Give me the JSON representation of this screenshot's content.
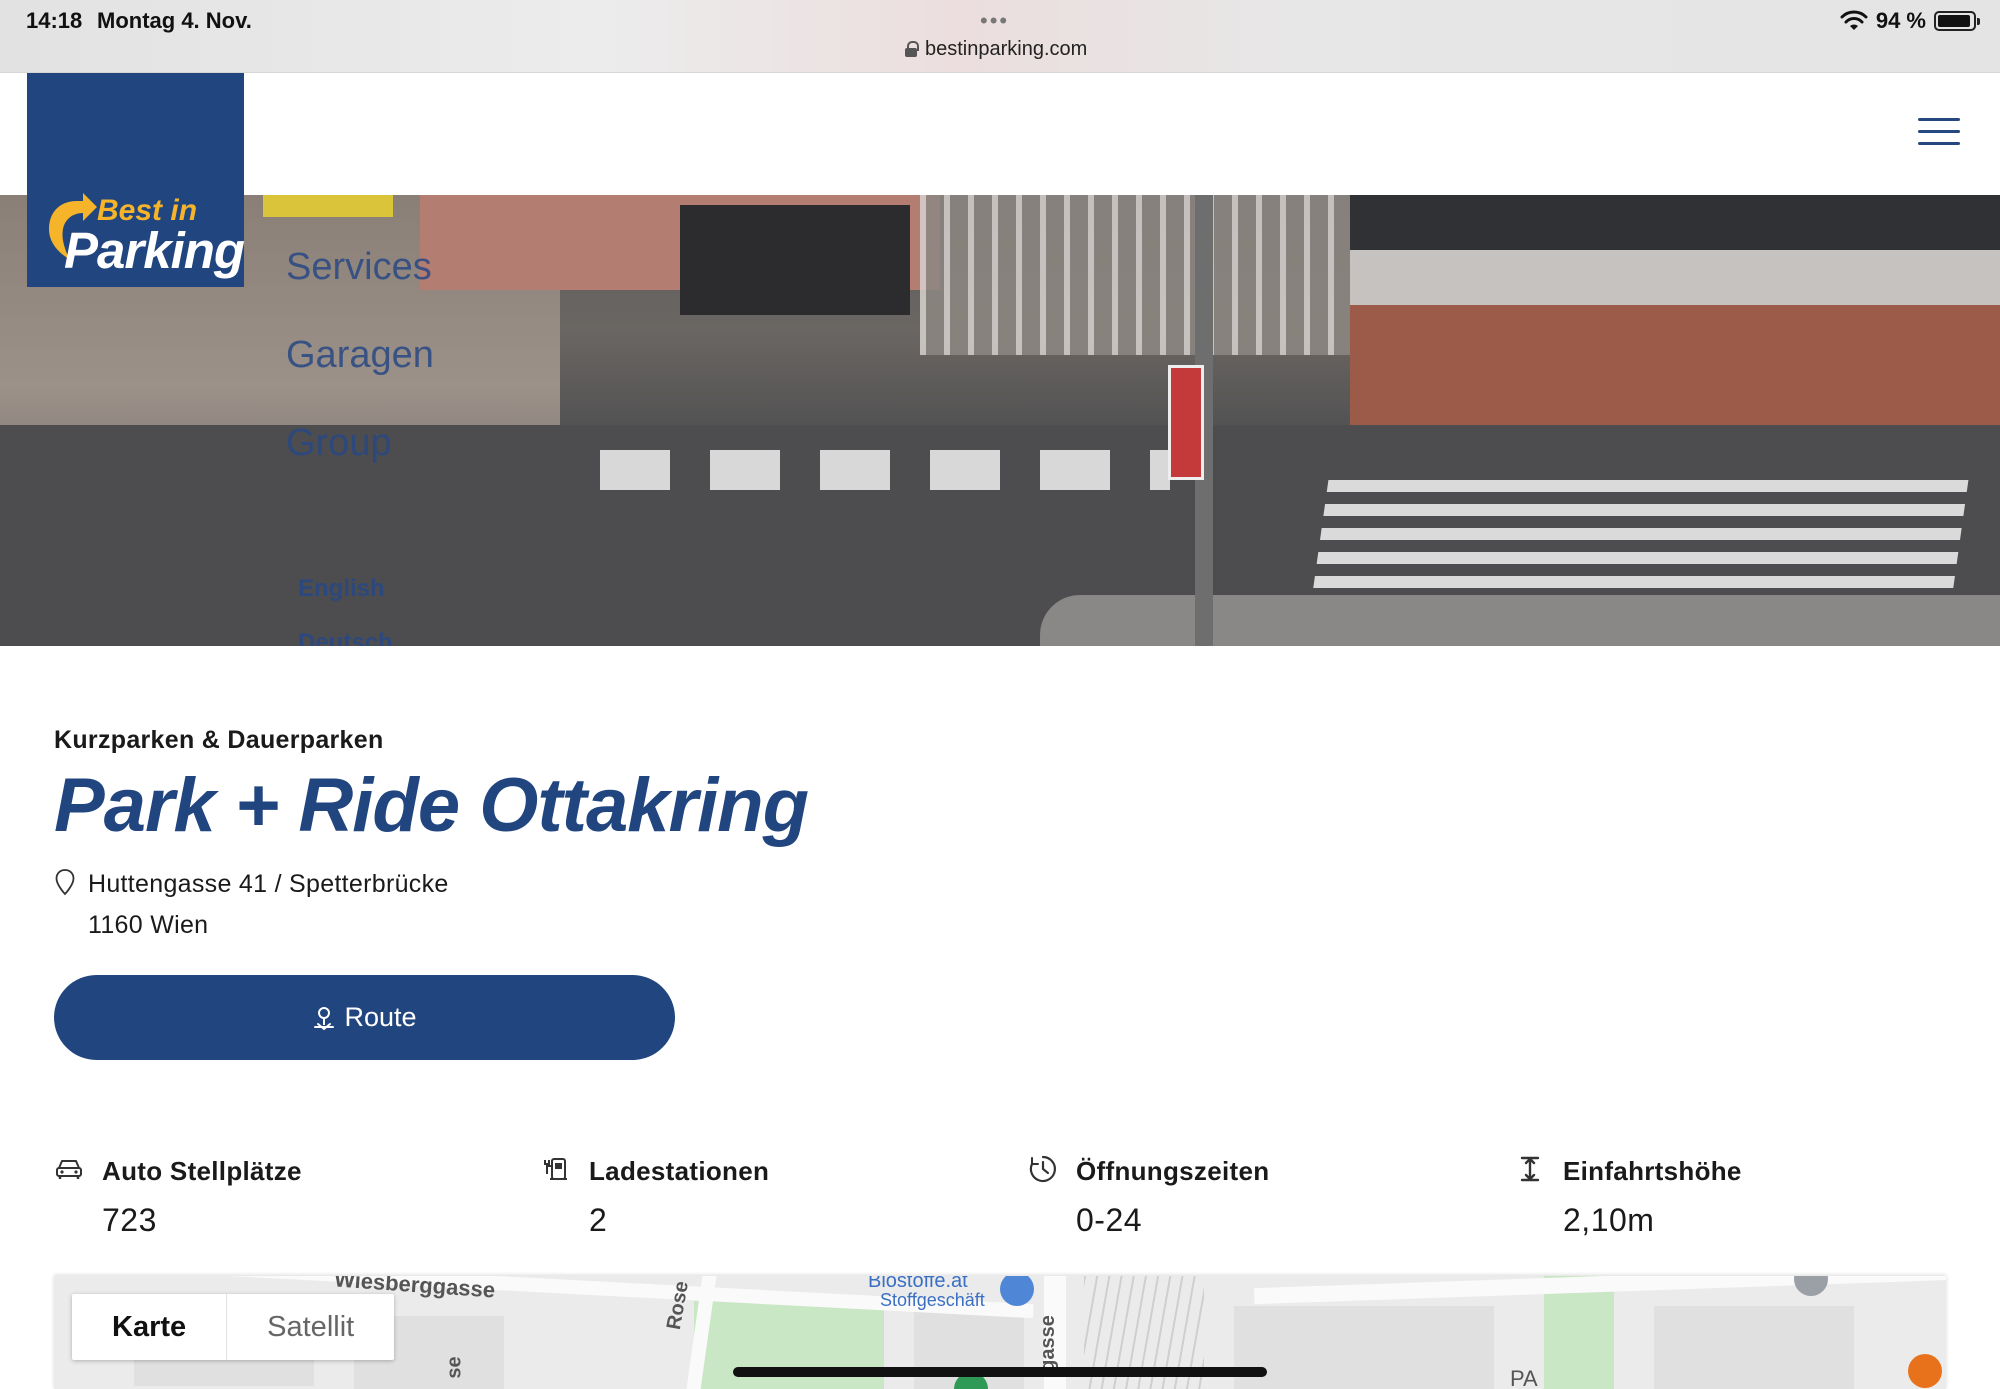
{
  "status_bar": {
    "time": "14:18",
    "date": "Montag 4. Nov.",
    "url": "bestinparking.com",
    "battery": "94 %",
    "battery_level": 0.94
  },
  "logo": {
    "line1": "Best in",
    "line2": "Parking"
  },
  "hero": {
    "nav": [
      "Services",
      "Garagen",
      "Group"
    ],
    "languages": [
      "English",
      "Deutsch"
    ]
  },
  "detail": {
    "subtitle": "Kurzparken & Dauerparken",
    "title": "Park + Ride Ottakring",
    "address_line1": "Huttengasse 41 / Spetterbrücke",
    "address_line2": "1160 Wien",
    "route_label": "Route"
  },
  "stats": [
    {
      "icon": "car-icon",
      "label": "Auto Stellplätze",
      "value": "723"
    },
    {
      "icon": "charging-station-icon",
      "label": "Ladestationen",
      "value": "2"
    },
    {
      "icon": "clock-icon",
      "label": "Öffnungszeiten",
      "value": "0-24"
    },
    {
      "icon": "height-icon",
      "label": "Einfahrtshöhe",
      "value": "2,10m"
    }
  ],
  "map": {
    "type_options": [
      "Karte",
      "Satellit"
    ],
    "selected": "Karte",
    "labels": {
      "street1": "Wiesberggasse",
      "street2": "Rose",
      "street3": "gasse",
      "poi_name": "Biostoffe.at",
      "poi_sub": "Stoffgeschäft",
      "area": "PA",
      "misc": "se"
    }
  },
  "colors": {
    "brand_blue": "#21457f",
    "logo_yellow": "#f5b42a"
  }
}
